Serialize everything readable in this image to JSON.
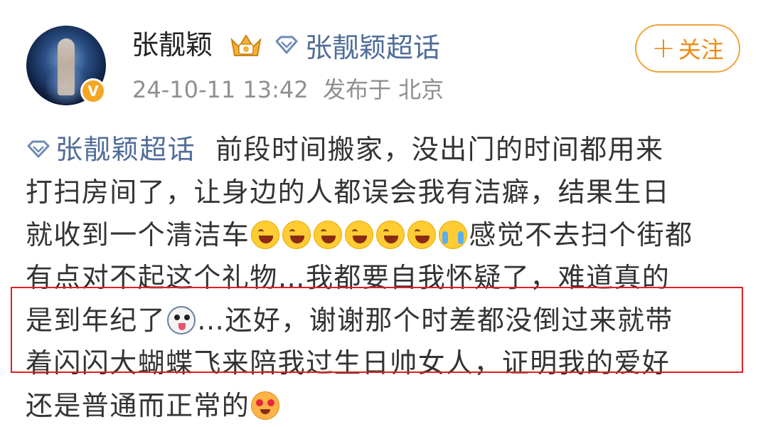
{
  "post": {
    "author_name": "张靓颖",
    "topic_link": "张靓颖超话",
    "follow_label": "关注",
    "follow_plus": "+",
    "timestamp": "24-10-11 13:42",
    "location": "发布于 北京",
    "verified_badge": "V"
  },
  "content": {
    "topic_tag": "张靓颖超话",
    "line1": "前段时间搬家，没出门的时间都用来",
    "line2": "打扫房间了，让身边的人都误会我有洁癖，结果生日",
    "line3a": "就收到一个清洁车",
    "line3b": "感觉不去扫个街都",
    "line4": "有点对不起这个礼物…我都要自我怀疑了，难道真的",
    "line5a": "是到年纪了",
    "line5b": "…还好，谢谢那个时差都没倒过来就带",
    "line6": "着闪闪大蝴蝶飞来陪我过生日帅女人，证明我的爱好",
    "line7": "还是普通而正常的"
  },
  "icons": {
    "crown": "crown-badge-icon",
    "topic": "diamond-topic-icon",
    "laugh": "laugh-cry-emoji",
    "cry": "crying-emoji",
    "dog": "dog-emoji",
    "love": "heart-eyes-emoji"
  },
  "colors": {
    "link": "#4f6c99",
    "follow": "#f08a12",
    "highlight_border": "#e01f25",
    "meta": "#8f8f8f"
  }
}
